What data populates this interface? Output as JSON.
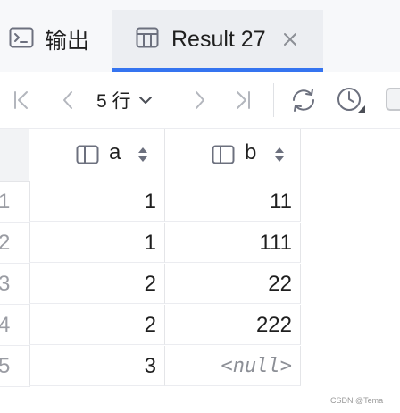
{
  "tabs": {
    "output_label": "输出",
    "result_label": "Result 27"
  },
  "toolbar": {
    "row_count_label": "5 行"
  },
  "table": {
    "columns": [
      {
        "name": "a"
      },
      {
        "name": "b"
      }
    ],
    "rows": [
      {
        "num": "1",
        "a": "1",
        "b": "11"
      },
      {
        "num": "2",
        "a": "1",
        "b": "111"
      },
      {
        "num": "3",
        "a": "2",
        "b": "22"
      },
      {
        "num": "4",
        "a": "2",
        "b": "222"
      },
      {
        "num": "5",
        "a": "3",
        "b": "<null>"
      }
    ]
  },
  "watermark": "CSDN @Tema",
  "colors": {
    "accent": "#3574f0",
    "tab_active_bg": "#eceef2",
    "icon_gray": "#6c707e"
  }
}
